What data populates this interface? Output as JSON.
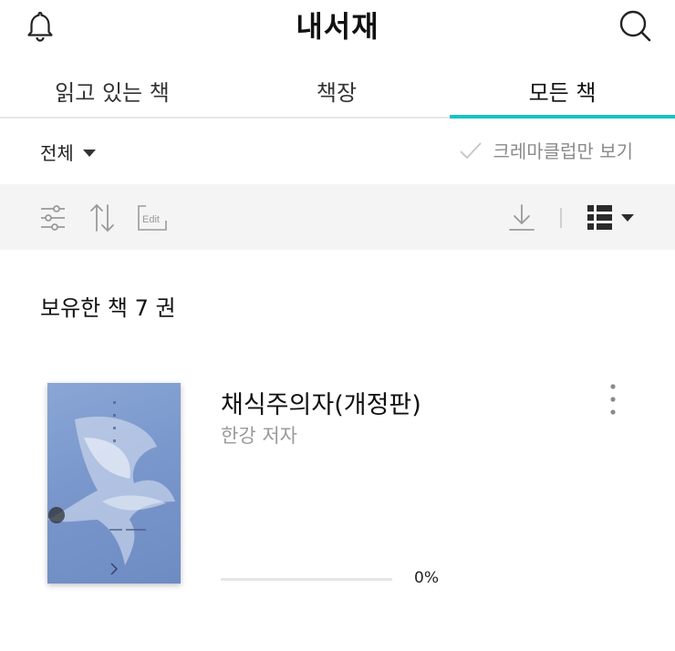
{
  "header": {
    "title": "내서재",
    "left_icon": "bell-icon",
    "right_icon": "search-icon"
  },
  "tabs": [
    {
      "label": "읽고 있는 책"
    },
    {
      "label": "책장"
    },
    {
      "label": "모든 책",
      "active": true
    }
  ],
  "filter": {
    "selected": "전체",
    "crema_label": "크레마클럽만 보기"
  },
  "toolbar": {
    "icons": [
      "sliders-icon",
      "sort-icon",
      "edit-icon",
      "download-icon",
      "list-view-icon"
    ],
    "edit_label": "Edit"
  },
  "library": {
    "count_label": "보유한 책 7 권"
  },
  "books": [
    {
      "title": "채식주의자(개정판)",
      "author": "한강 저자",
      "progress": 0,
      "progress_label": "0%"
    }
  ],
  "colors": {
    "accent": "#17c3c5",
    "toolbar_bg": "#f4f4f4",
    "cover": "#7a97cc"
  }
}
